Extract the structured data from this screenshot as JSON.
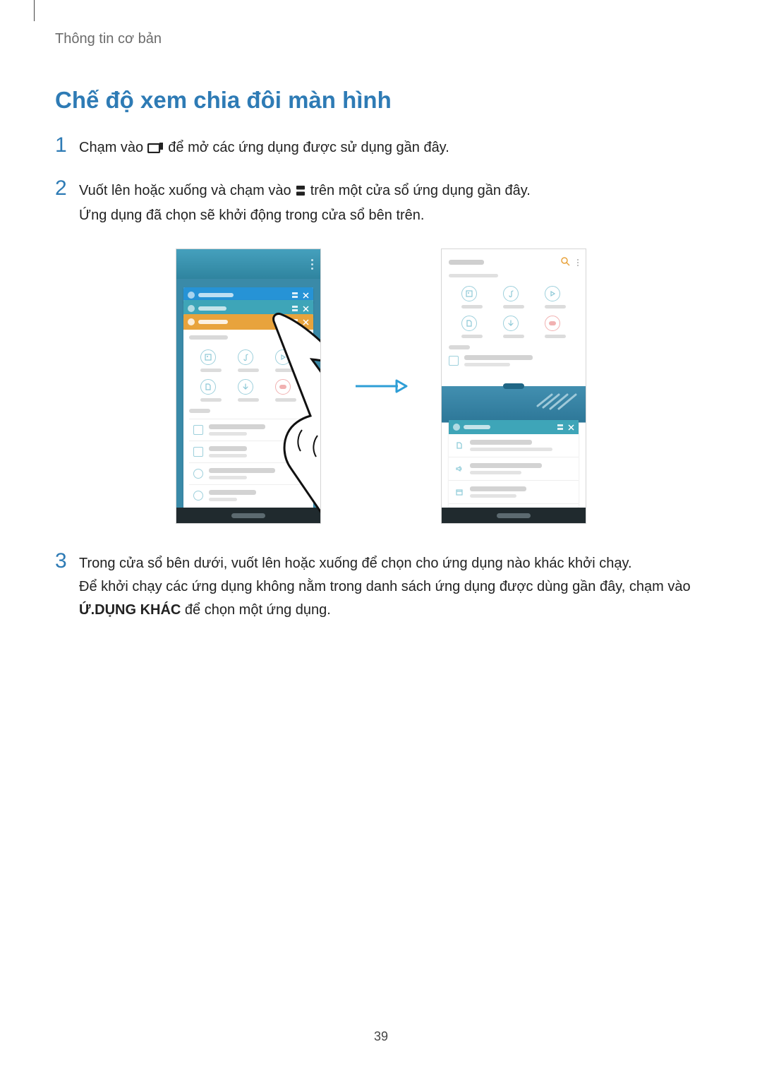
{
  "breadcrumb": "Thông tin cơ bản",
  "heading": "Chế độ xem chia đôi màn hình",
  "step1": {
    "num": "1",
    "text_before": "Chạm vào ",
    "text_after": " để mở các ứng dụng được sử dụng gần đây."
  },
  "step2": {
    "num": "2",
    "line1_before": "Vuốt lên hoặc xuống và chạm vào ",
    "line1_after": " trên một cửa sổ ứng dụng gần đây.",
    "line2": "Ứng dụng đã chọn sẽ khởi động trong cửa sổ bên trên."
  },
  "step3": {
    "num": "3",
    "line1": "Trong cửa sổ bên dưới, vuốt lên hoặc xuống để chọn cho ứng dụng nào khác khởi chạy.",
    "line2_before": "Để khởi chạy các ứng dụng không nằm trong danh sách ứng dụng được dùng gần đây, chạm vào ",
    "bold": "Ứ.DỤNG KHÁC",
    "line2_after": " để chọn một ứng dụng."
  },
  "page_number": "39"
}
